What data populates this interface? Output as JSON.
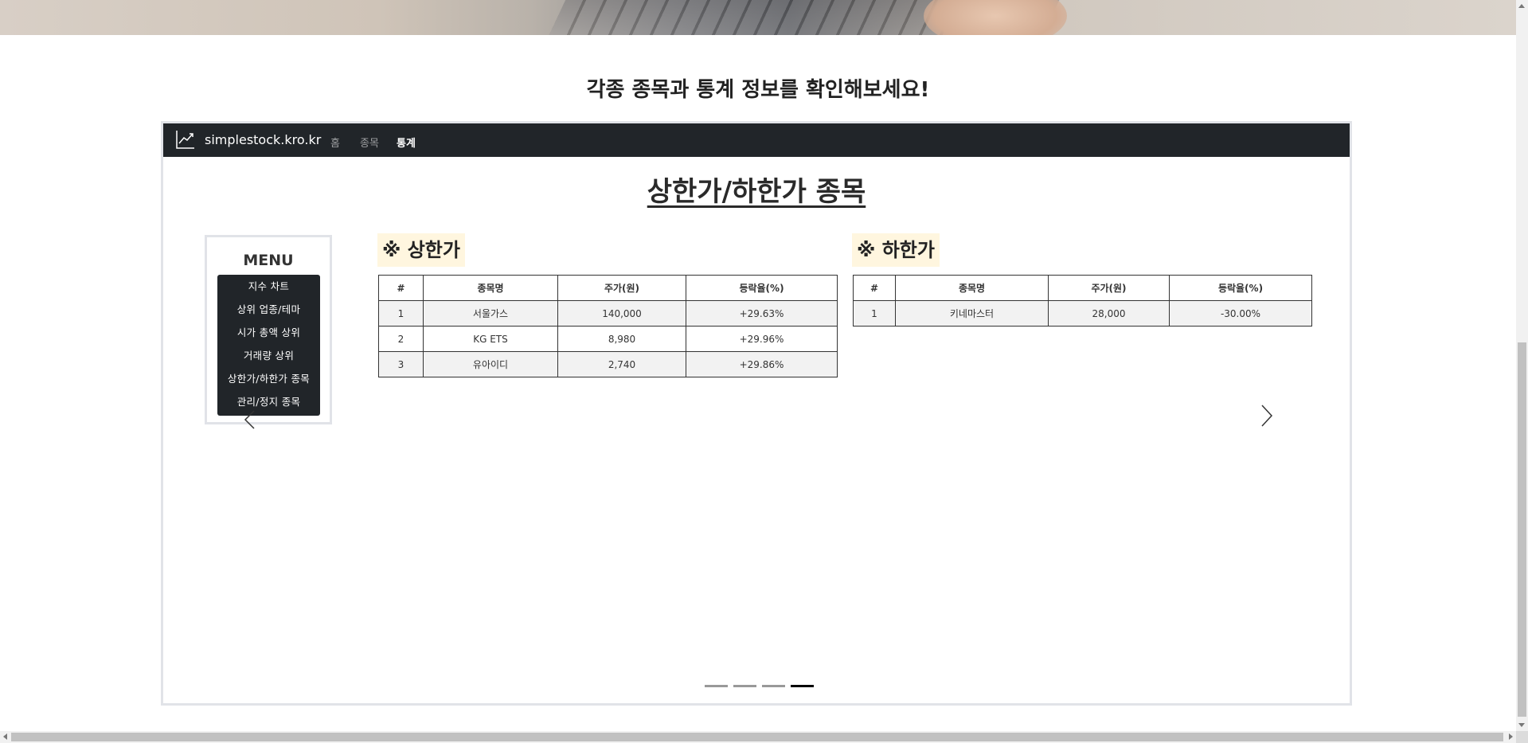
{
  "section_title": "각종 종목과 통계 정보를 확인해보세요!",
  "navbar": {
    "brand": "simplestock.kro.kr",
    "links": [
      "홈",
      "종목",
      "통계"
    ],
    "active_index": 2
  },
  "page_heading": "상한가/하한가 종목",
  "menu": {
    "title": "MENU",
    "items": [
      "지수 차트",
      "상위 업종/테마",
      "시가 총액 상위",
      "거래량 상위",
      "상한가/하한가 종목",
      "관리/정지 종목"
    ]
  },
  "upper_limit": {
    "label": "※ 상한가",
    "columns": [
      "#",
      "종목명",
      "주가(원)",
      "등락율(%)"
    ],
    "rows": [
      [
        "1",
        "서울가스",
        "140,000",
        "+29.63%"
      ],
      [
        "2",
        "KG ETS",
        "8,980",
        "+29.96%"
      ],
      [
        "3",
        "유아이디",
        "2,740",
        "+29.86%"
      ]
    ]
  },
  "lower_limit": {
    "label": "※ 하한가",
    "columns": [
      "#",
      "종목명",
      "주가(원)",
      "등락율(%)"
    ],
    "rows": [
      [
        "1",
        "키네마스터",
        "28,000",
        "-30.00%"
      ]
    ]
  },
  "carousel": {
    "slide_count": 4,
    "active_slide": 4
  },
  "colors": {
    "navbar_bg": "#212529",
    "label_highlight": "#fff6df",
    "frame_border": "#e1e3e8"
  }
}
